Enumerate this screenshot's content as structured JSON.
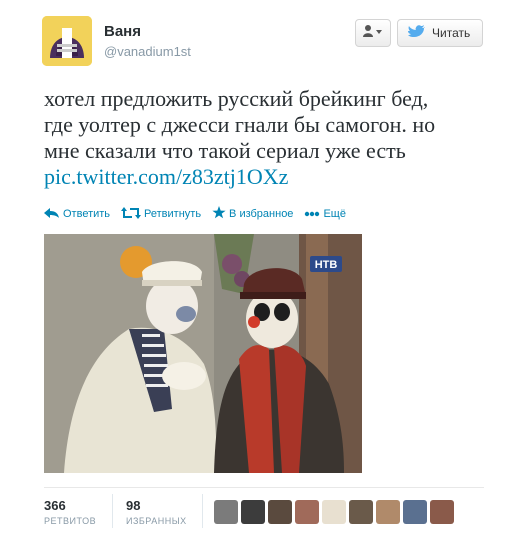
{
  "header": {
    "name": "Ваня",
    "handle": "@vanadium1st",
    "follow_label": "Читать"
  },
  "tweet": {
    "line1": "хотел предложить русский брейкинг бед,",
    "line2": "где уолтер с джесси гнали бы самогон. но",
    "line3": "мне сказали что такой сериал уже есть",
    "link": "pic.twitter.com/z83ztj1OXz"
  },
  "actions": {
    "reply": "Ответить",
    "retweet": "Ретвитнуть",
    "favorite": "В избранное",
    "more": "Ещё"
  },
  "photo": {
    "watermark": "НТВ"
  },
  "stats": {
    "retweets_count": "366",
    "retweets_label": "РЕТВИТОВ",
    "favorites_count": "98",
    "favorites_label": "ИЗБРАННЫХ"
  },
  "colors": {
    "link": "#0084b4",
    "twitter_bird": "#55acee",
    "muted": "#8899a6"
  },
  "icons": [
    "user-dropdown-icon",
    "twitter-bird-icon",
    "reply-icon",
    "retweet-icon",
    "star-icon",
    "more-dots-icon"
  ]
}
